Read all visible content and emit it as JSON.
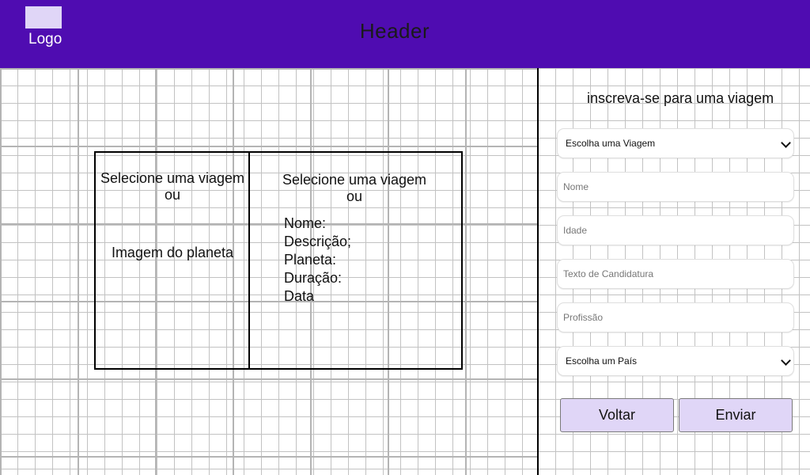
{
  "header": {
    "logo_label": "Logo",
    "title": "Header",
    "background": "#4f0cb1",
    "logo_color": "#e0d6f7"
  },
  "content": {
    "left": {
      "select_line1": "Selecione uma viagem",
      "select_line2": "ou",
      "image_label": "Imagem do planeta"
    },
    "right": {
      "select_line1": "Selecione uma viagem",
      "select_line2": "ou",
      "details": [
        "Nome:",
        "Descrição;",
        "Planeta:",
        "Duração:",
        "Data"
      ]
    }
  },
  "form": {
    "title": "inscreva-se para uma viagem",
    "trip_select": "Escolha uma Viagem",
    "name_placeholder": "Nome",
    "age_placeholder": "Idade",
    "application_placeholder": "Texto de Candidatura",
    "profession_placeholder": "Profissão",
    "country_select": "Escolha um País",
    "back_button": "Voltar",
    "submit_button": "Enviar",
    "button_color": "#e0d6f7"
  }
}
